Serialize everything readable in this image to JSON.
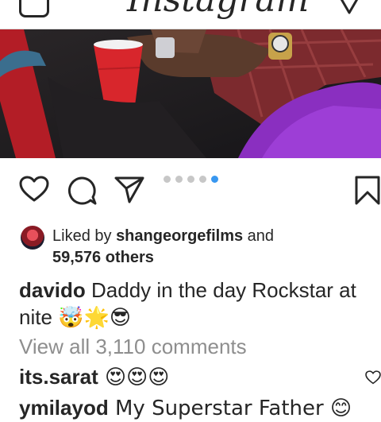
{
  "header": {
    "logo_text": "Instagram",
    "camera_icon": "camera-icon",
    "direct_icon": "direct-message-icon"
  },
  "post": {
    "carousel": {
      "count": 5,
      "active_index": 4,
      "active_color": "#3897f0",
      "inactive_color": "#c7c7c7"
    },
    "icons": [
      "heart-icon",
      "comment-icon",
      "share-icon",
      "bookmark-icon"
    ],
    "likes": {
      "prefix": "Liked by ",
      "user": "shangeorgefilms",
      "conj": " and",
      "others": "59,576 others"
    },
    "caption": {
      "user": "davido",
      "text": " Daddy in the day Rockstar at nite ",
      "emojis": "🤯🌟😎"
    },
    "view_all": "View all 3,110 comments",
    "comments": [
      {
        "user": "its.sarat",
        "text": " 😍😍😍"
      },
      {
        "user": "ymilayod",
        "text": " My Superstar Father 😊"
      }
    ]
  }
}
